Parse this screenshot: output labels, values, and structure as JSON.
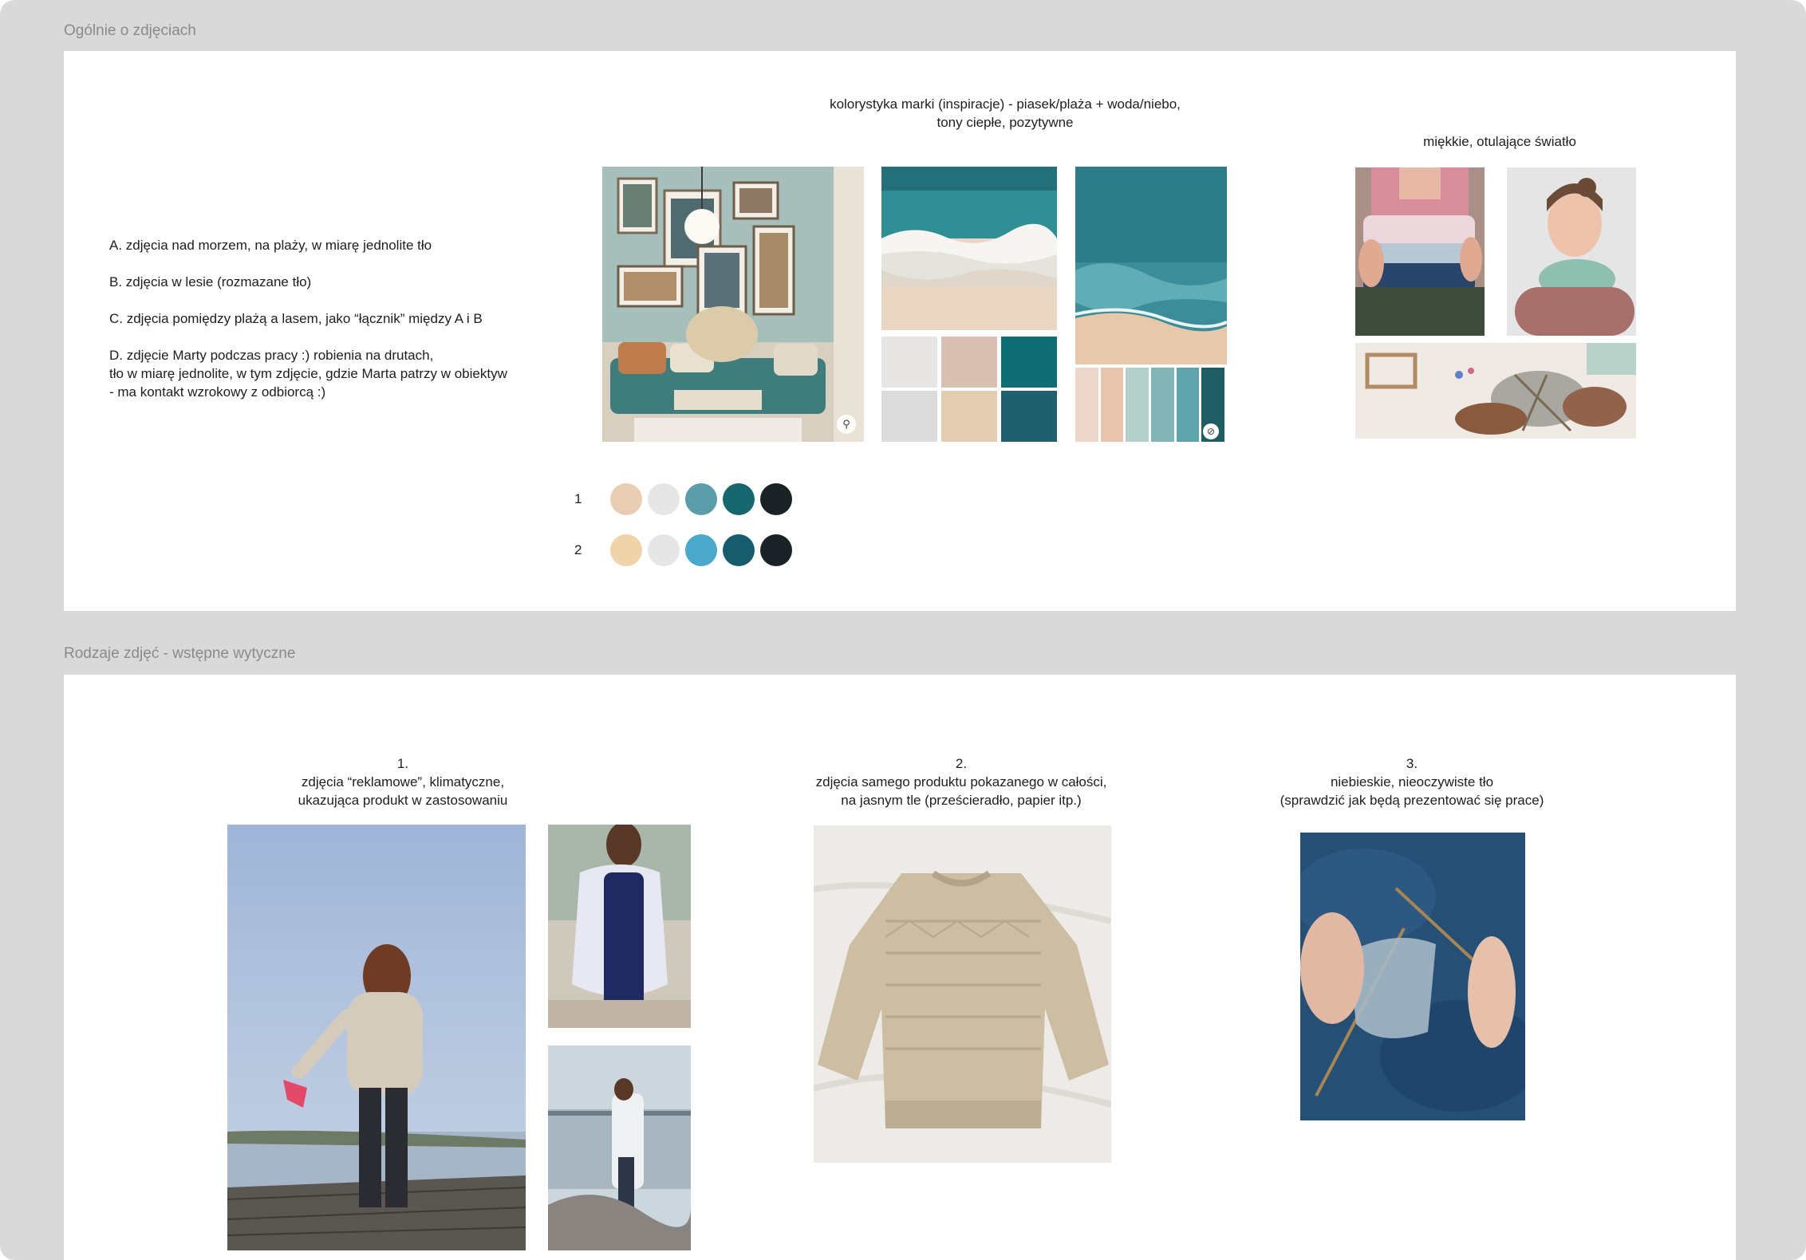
{
  "sections": [
    {
      "label": "Ogólnie o zdjęciach"
    },
    {
      "label": "Rodzaje zdjęć - wstępne wytyczne"
    }
  ],
  "overview": {
    "brief_items": [
      "A. zdjęcia nad morzem, na plaży, w miarę jednolite tło",
      "B. zdjęcia w lesie (rozmazane tło)",
      "C. zdjęcia pomiędzy plażą a lasem, jako “łącznik” między A i B",
      "D. zdjęcie Marty podczas pracy :) robienia na drutach,",
      "tło w miarę jednolite, w tym zdjęcie, gdzie Marta patrzy w obiektyw",
      "- ma kontakt wzrokowy z odbiorcą :)"
    ],
    "palette_title_1": "kolorystyka marki (inspiracje) - piasek/plaża + woda/niebo,",
    "palette_title_2": "tony ciepłe, pozytywne",
    "light_title": "miękkie, otulające światło",
    "palette_rows": [
      {
        "label": "1",
        "colors": [
          "#e8cdb2",
          "#e6e6e6",
          "#5b9eaa",
          "#176770",
          "#1b2226"
        ]
      },
      {
        "label": "2",
        "colors": [
          "#f0d2ab",
          "#e6e6e6",
          "#4aa8cb",
          "#165c6c",
          "#1b2226"
        ]
      }
    ],
    "moodboard_swatches": [
      "#e8e6e4",
      "#d8c1b2",
      "#0e6e74",
      "#dcdcdc",
      "#e2cdb0",
      "#1f5f6e"
    ],
    "stripe_colors": [
      "#edd7cb",
      "#e9c4ad",
      "#b4d0ca",
      "#82b6b6",
      "#5fa3ad",
      "#1e5e62"
    ],
    "icons": [
      "zoom-icon",
      "badge-icon"
    ]
  },
  "guidelines": {
    "col1_num": "1.",
    "col1_line1": "zdjęcia “reklamowe”, klimatyczne,",
    "col1_line2": "ukazująca produkt w zastosowaniu",
    "col2_num": "2.",
    "col2_line1": "zdjęcia samego produktu pokazanego w całości,",
    "col2_line2": "na jasnym tle (prześcieradło, papier itp.)",
    "col3_num": "3.",
    "col3_line1": "niebieskie, nieoczywiste tło",
    "col3_line2": "(sprawdzić jak będą prezentować się prace)"
  }
}
